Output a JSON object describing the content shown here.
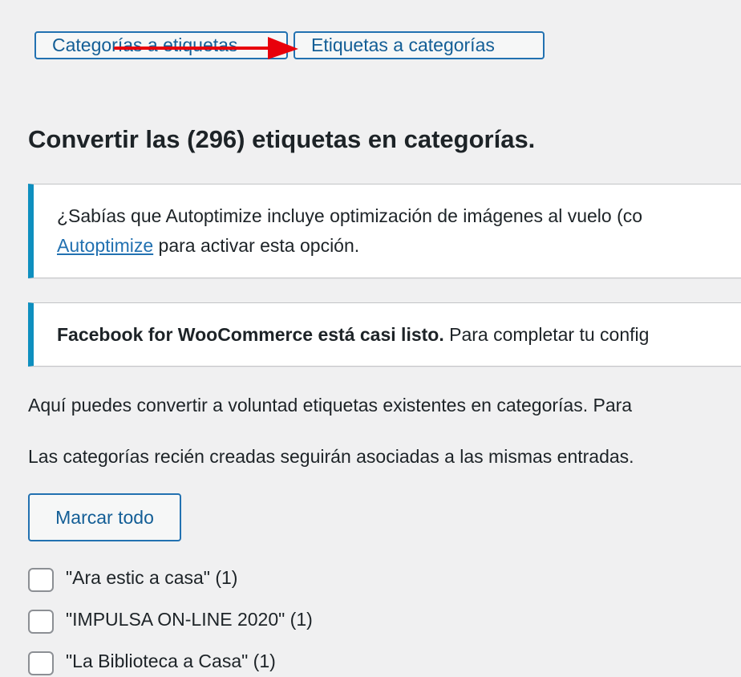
{
  "tabs": {
    "categories_to_tags": "Categorías a etiquetas",
    "tags_to_categories": "Etiquetas a categorías"
  },
  "annotation": {
    "arrow_color": "#e8000b"
  },
  "page_title": "Convertir las (296) etiquetas en categorías.",
  "notices": {
    "autoptimize": {
      "text_line1": "¿Sabías que Autoptimize incluye optimización de imágenes al vuelo (co",
      "link_text": "Autoptimize",
      "text_line2_after_link": " para activar esta opción."
    },
    "facebook": {
      "bold_text": "Facebook for WooCommerce está casi listo.",
      "rest_text": " Para completar tu config"
    }
  },
  "description": {
    "intro": "Aquí puedes convertir a voluntad etiquetas existentes en categorías. Para",
    "created": "Las categorías recién creadas seguirán asociadas a las mismas entradas."
  },
  "mark_all_button": "Marcar todo",
  "tag_list": [
    {
      "label": "\"Ara estic a casa\" (1)",
      "checked": false
    },
    {
      "label": "\"IMPULSA ON-LINE 2020\" (1)",
      "checked": false
    },
    {
      "label": "\"La Biblioteca a Casa\" (1)",
      "checked": false
    }
  ],
  "colors": {
    "accent": "#2271b1",
    "notice_border": "#0e8fbf",
    "background": "#f0f0f1"
  }
}
